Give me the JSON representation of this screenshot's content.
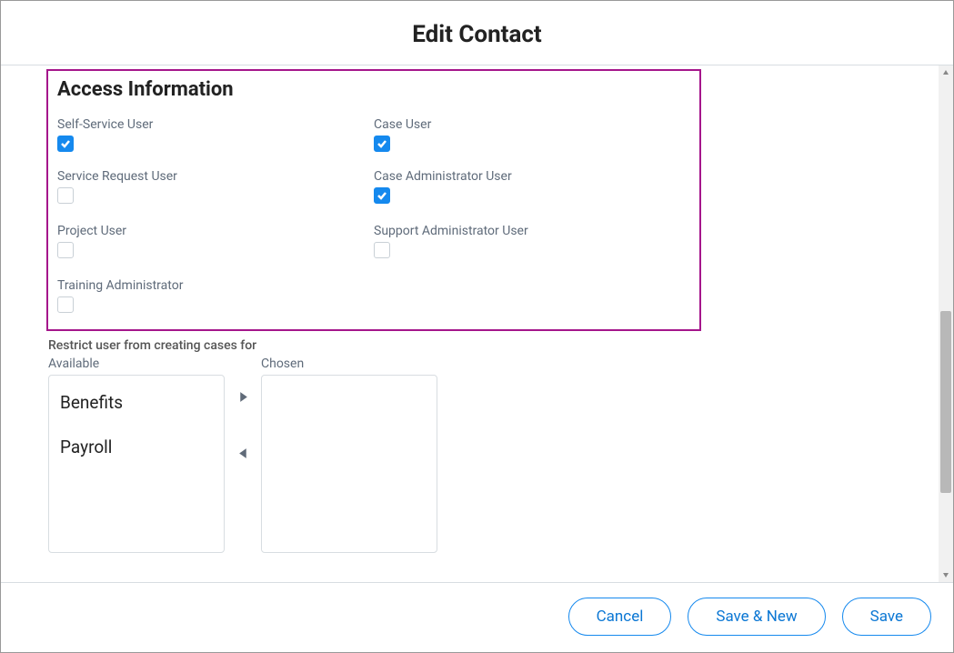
{
  "header": {
    "title": "Edit Contact"
  },
  "section": {
    "title": "Access Information",
    "checkboxes": {
      "left": [
        {
          "label": "Self-Service User",
          "checked": true
        },
        {
          "label": "Service Request User",
          "checked": false
        },
        {
          "label": "Project User",
          "checked": false
        },
        {
          "label": "Training Administrator",
          "checked": false
        }
      ],
      "right": [
        {
          "label": "Case User",
          "checked": true
        },
        {
          "label": "Case Administrator User",
          "checked": true
        },
        {
          "label": "Support Administrator User",
          "checked": false
        }
      ]
    }
  },
  "restrict": {
    "label": "Restrict user from creating cases for",
    "available_label": "Available",
    "chosen_label": "Chosen",
    "available": [
      "Benefits",
      "Payroll"
    ],
    "chosen": []
  },
  "footer": {
    "cancel": "Cancel",
    "save_new": "Save & New",
    "save": "Save"
  }
}
